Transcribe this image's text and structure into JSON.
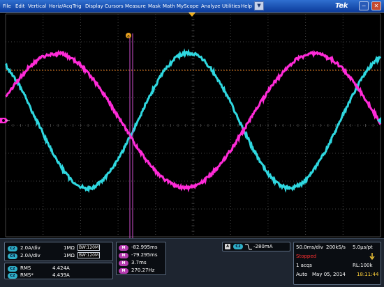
{
  "menu": {
    "items": [
      "File",
      "Edit",
      "Vertical",
      "Horiz/Acq",
      "Trig",
      "Display",
      "Cursors",
      "Measure",
      "Mask",
      "Math",
      "MyScope",
      "Analyze",
      "Utilities",
      "Help"
    ],
    "dropdown_symbol": "▼",
    "brand": "Tek",
    "minimize_symbol": "−",
    "close_symbol": "✕"
  },
  "display": {
    "cursor_label": "a",
    "colors": {
      "ch2": "#2fd8e0",
      "math": "#ff2bd8",
      "cursor": "#d24fd2",
      "trigger_level": "#e0781a",
      "grid": "#444444",
      "trigger_pos": "#f0b020"
    }
  },
  "channels": [
    {
      "badge": "C2",
      "scale": "2.0A/div",
      "coupling": "1MΩ",
      "bw": "BW:120M"
    },
    {
      "badge": "C4",
      "scale": "2.0A/div",
      "coupling": "1MΩ",
      "bw": "BW:120M"
    }
  ],
  "measurements": [
    {
      "badge": "C2",
      "name": "RMS",
      "value": "4.424A"
    },
    {
      "badge": "C2",
      "name": "RMS*",
      "value": "4.439A"
    }
  ],
  "math_values": [
    {
      "badge": "M",
      "value": "-82.995ms"
    },
    {
      "badge": "M",
      "value": "-79.295ms"
    },
    {
      "badge": "M",
      "value": "3.7ms"
    },
    {
      "badge": "M",
      "value": "270.27Hz"
    }
  ],
  "trigger": {
    "mode_badge": "A",
    "source_badge": "C2",
    "level": "-280mA"
  },
  "acquisition": {
    "timebase": "50.0ms/div",
    "sample_rate": "200kS/s",
    "resolution": "5.0µs/pt",
    "state": "Stopped",
    "acqs": "1 acqs",
    "record_length": "RL:100k",
    "mode": "Auto",
    "date": "May 05, 2014",
    "time": "18:11:44"
  }
}
